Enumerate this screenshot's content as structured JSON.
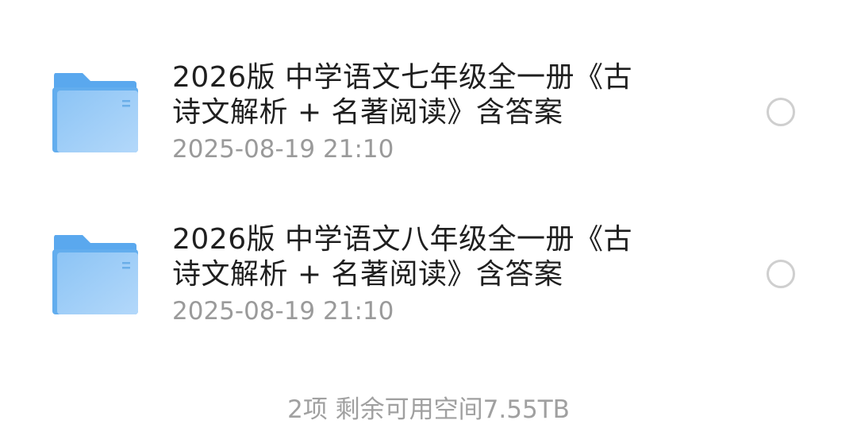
{
  "files": [
    {
      "name_line1": "2026版 中学语文七年级全一册《古",
      "name_line2": "诗文解析 + 名著阅读》含答案",
      "modified": "2025-08-19 21:10",
      "icon": "folder-icon"
    },
    {
      "name_line1": "2026版 中学语文八年级全一册《古",
      "name_line2": "诗文解析 + 名著阅读》含答案",
      "modified": "2025-08-19 21:10",
      "icon": "folder-icon"
    }
  ],
  "footer": {
    "summary": "2项 剩余可用空间7.55TB"
  },
  "colors": {
    "folder_back": "#5aa8ee",
    "folder_front_start": "#8cc4f5",
    "folder_front_end": "#b3d8fa",
    "title_text": "#1f1f1f",
    "meta_text": "#9a9a9a",
    "radio_border": "#cfcfcf"
  }
}
